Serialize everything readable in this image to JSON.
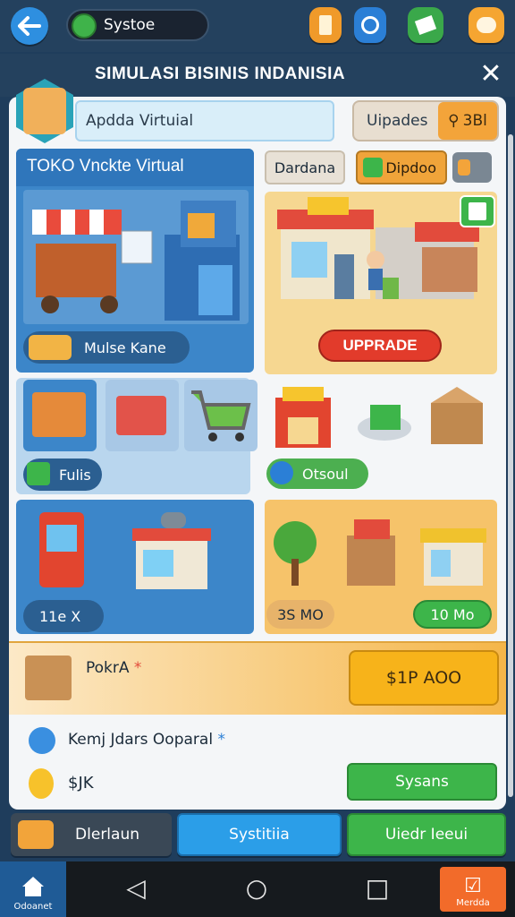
{
  "topbar": {
    "system_label": "Systoe",
    "icons": [
      "back-arrow-icon",
      "scroll-icon",
      "swirl-icon",
      "notepad-icon",
      "chat-icon"
    ]
  },
  "header": {
    "title": "SIMULASI BISINIS INDANISIA"
  },
  "profile": {
    "field_value": "Apdda Virtuial",
    "updates_label": "Uipades",
    "updates_chip": "3Bl"
  },
  "left": {
    "store_title": "TOKO Vnckte Virtual",
    "chip1": "Mulse Kane",
    "chip2": "Fulis",
    "chip3": "11e X"
  },
  "right": {
    "tab1": "Dardana",
    "tab2": "Dipdoo",
    "upgrade": "UPPRADE",
    "chip_green": "Otsoul",
    "chip_s3": "3S MO",
    "chip_10": "10 Mo"
  },
  "pokra": {
    "label": "PokrA",
    "price": "$1P AOO"
  },
  "info": {
    "kemj": "Kemj Jdars Ooparal",
    "jk": "$JK",
    "sysans": "Sysans"
  },
  "footer": {
    "btn1": "Dlerlaun",
    "btn2": "Systitiia",
    "btn3": "Uiedr Ieeui"
  },
  "navbar": {
    "home": "Odoanet",
    "right": "Merdda"
  },
  "colors": {
    "primary_blue": "#2b7fd6",
    "accent_orange": "#f5a531",
    "green": "#3db54a",
    "danger": "#e23b2b"
  }
}
